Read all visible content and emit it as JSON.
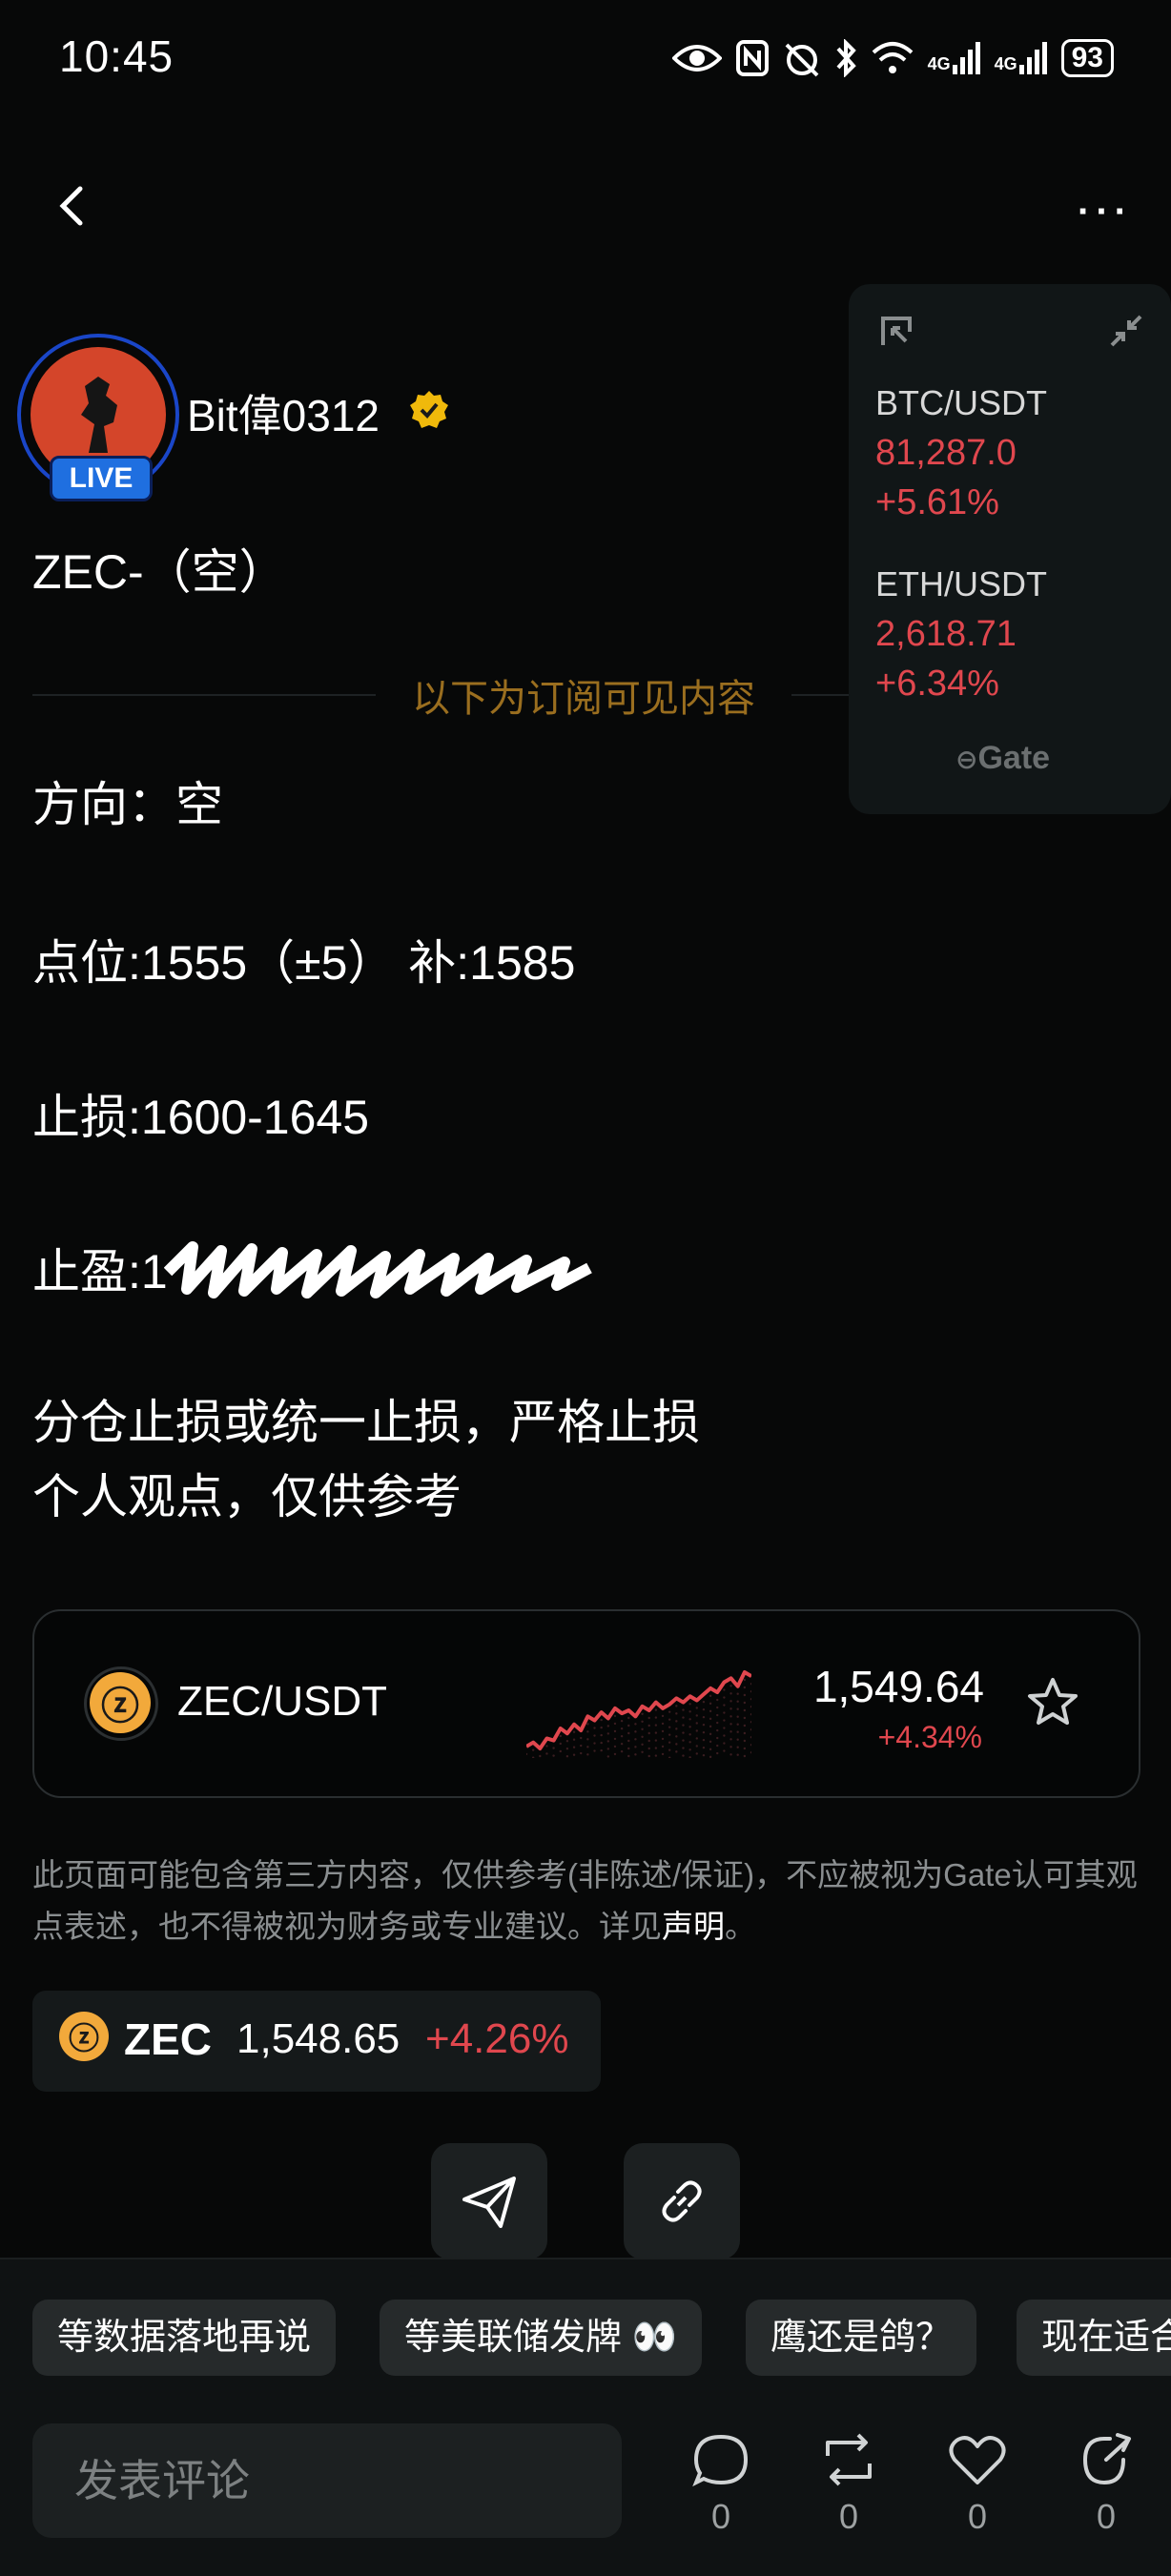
{
  "status_bar": {
    "time": "10:45",
    "network_1": "4G",
    "network_2": "4G",
    "battery": "93"
  },
  "author": {
    "name": "Bit偉0312",
    "live_badge": "LIVE"
  },
  "post": {
    "title": "ZEC-（空）",
    "subscribe_note": "以下为订阅可见内容",
    "direction": "方向：空",
    "entry": "点位:1555（±5） 补:1585",
    "stop_loss": "止损:1600-1645",
    "take_profit_prefix": "止盈:1",
    "note_1": " 分仓止损或统一止损，严格止损",
    "note_2": "个人观点，仅供参考"
  },
  "widget": {
    "items": [
      {
        "pair": "BTC/USDT",
        "price": "81,287.0",
        "change": "+5.61%"
      },
      {
        "pair": "ETH/USDT",
        "price": "2,618.71",
        "change": "+6.34%"
      }
    ],
    "brand": "Gate"
  },
  "market_card": {
    "pair": "ZEC/USDT",
    "price": "1,549.64",
    "change": "+4.34%",
    "sparkline": [
      22,
      26,
      20,
      30,
      28,
      40,
      35,
      44,
      38,
      52,
      48,
      56,
      50,
      60,
      55,
      58,
      52,
      62,
      58,
      66,
      60,
      64,
      70,
      66,
      72,
      68,
      74,
      80,
      76,
      86,
      90,
      82,
      96,
      92
    ]
  },
  "disclaimer": {
    "text": "此页面可能包含第三方内容，仅供参考(非陈述/保证)，不应被视为Gate认可其观点表述，也不得被视为财务或专业建议。详见",
    "link": "声明",
    "end": "。"
  },
  "ticker": {
    "symbol": "ZEC",
    "price": "1,548.65",
    "change": "+4.26%"
  },
  "chips": [
    "等数据落地再说",
    "等美联储发牌 👀",
    "鹰还是鸽？",
    "现在适合"
  ],
  "comment_placeholder": "发表评论",
  "actions": [
    {
      "name": "comment",
      "count": "0"
    },
    {
      "name": "repost",
      "count": "0"
    },
    {
      "name": "like",
      "count": "0"
    },
    {
      "name": "share",
      "count": "0"
    }
  ],
  "colors": {
    "down_red": "#e0474e",
    "gold": "#9a6e1f",
    "live_blue": "#1f6fe0"
  }
}
